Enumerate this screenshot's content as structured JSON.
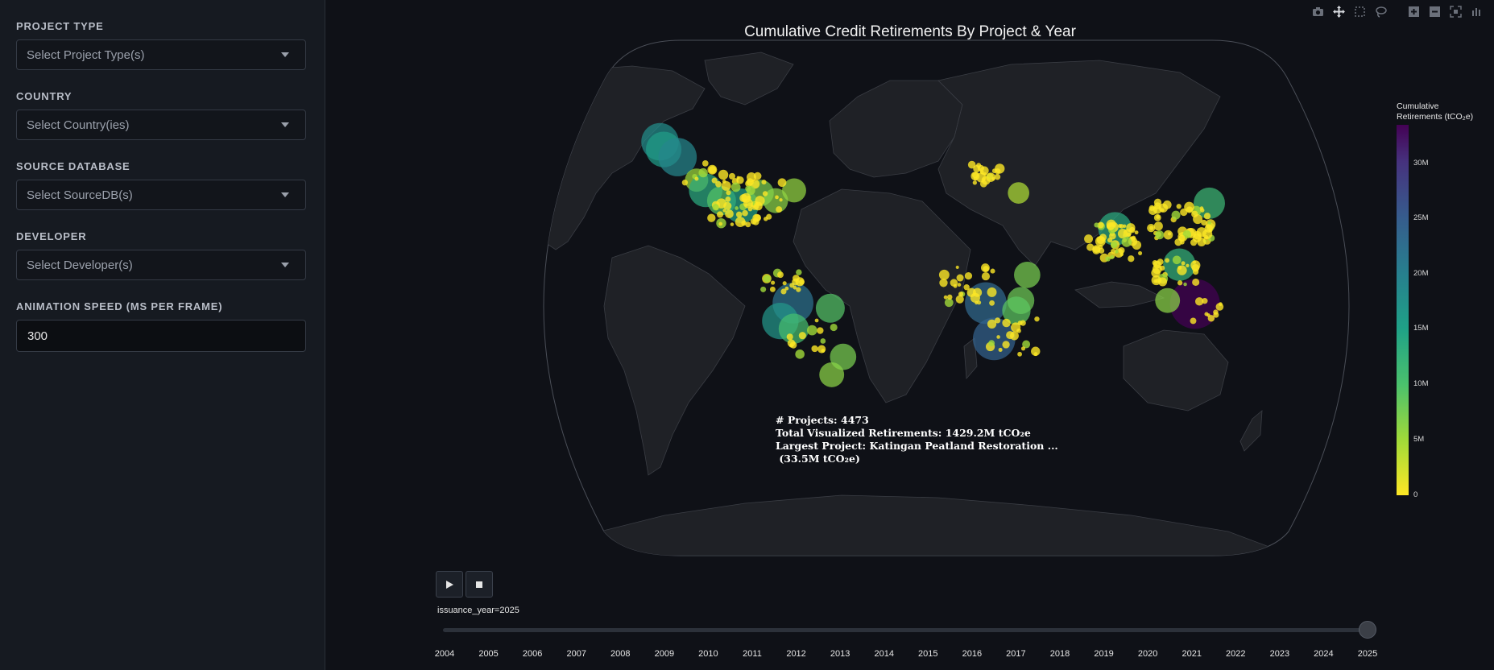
{
  "sidebar": {
    "filters": [
      {
        "label": "PROJECT TYPE",
        "placeholder": "Select Project Type(s)"
      },
      {
        "label": "COUNTRY",
        "placeholder": "Select Country(ies)"
      },
      {
        "label": "SOURCE DATABASE",
        "placeholder": "Select SourceDB(s)"
      },
      {
        "label": "DEVELOPER",
        "placeholder": "Select Developer(s)"
      }
    ],
    "speed": {
      "label": "ANIMATION SPEED (MS PER FRAME)",
      "value": "300"
    }
  },
  "modebar": {
    "icons": [
      "camera-icon",
      "pan-icon",
      "box-select-icon",
      "lasso-icon",
      "zoom-in-icon",
      "zoom-out-icon",
      "reset-view-icon",
      "plotly-logo-icon"
    ]
  },
  "chart": {
    "title": "Cumulative Credit Retirements By Project & Year",
    "annotation": "# Projects: 4473\nTotal Visualized Retirements: 1429.2M tCO₂e\nLargest Project: Katingan Peatland Restoration ...\n (33.5M tCO₂e)",
    "colorbar": {
      "title": "Cumulative\nRetirements (tCO₂e)",
      "ticks": [
        "30M",
        "25M",
        "20M",
        "15M",
        "10M",
        "5M",
        "0"
      ],
      "colors": [
        "#440154",
        "#46327e",
        "#365c8d",
        "#277f8e",
        "#1fa187",
        "#4ac16d",
        "#a0da39",
        "#fde725"
      ]
    },
    "slider": {
      "label": "issuance_year=2025",
      "years": [
        "2004",
        "2005",
        "2006",
        "2007",
        "2008",
        "2009",
        "2010",
        "2011",
        "2012",
        "2013",
        "2014",
        "2015",
        "2016",
        "2017",
        "2018",
        "2019",
        "2020",
        "2021",
        "2022",
        "2023",
        "2024",
        "2025"
      ],
      "current": "2025"
    },
    "play_icon": "play-icon",
    "stop_icon": "stop-icon"
  },
  "chart_data": {
    "type": "scatter",
    "subtype": "scatter_geo",
    "title": "Cumulative Credit Retirements By Project & Year",
    "colorbar_title": "Cumulative Retirements (tCO₂e)",
    "color_range": [
      0,
      33500000
    ],
    "projection": "robinson",
    "frame": "2025",
    "points": [
      {
        "lon": -150,
        "lat": 61,
        "value": 17000000
      },
      {
        "lon": -146,
        "lat": 58,
        "value": 15000000
      },
      {
        "lon": -137,
        "lat": 55,
        "value": 18000000
      },
      {
        "lon": -123,
        "lat": 46,
        "value": 5000000
      },
      {
        "lon": -117,
        "lat": 42,
        "value": 13000000
      },
      {
        "lon": -108,
        "lat": 38,
        "value": 9000000
      },
      {
        "lon": -98,
        "lat": 36,
        "value": 14000000
      },
      {
        "lon": -90,
        "lat": 41,
        "value": 7000000
      },
      {
        "lon": -82,
        "lat": 38,
        "value": 6000000
      },
      {
        "lon": -74,
        "lat": 42,
        "value": 5500000
      },
      {
        "lon": -70,
        "lat": -2,
        "value": 21000000
      },
      {
        "lon": -76,
        "lat": -9,
        "value": 16000000
      },
      {
        "lon": -70,
        "lat": -12,
        "value": 10000000
      },
      {
        "lon": -53,
        "lat": -4,
        "value": 9000000
      },
      {
        "lon": -48,
        "lat": -23,
        "value": 7000000
      },
      {
        "lon": -54,
        "lat": -30,
        "value": 6000000
      },
      {
        "lon": 18,
        "lat": -2,
        "value": 22000000
      },
      {
        "lon": 22,
        "lat": -16,
        "value": 23000000
      },
      {
        "lon": 34,
        "lat": -1,
        "value": 7500000
      },
      {
        "lon": 32,
        "lat": -5,
        "value": 8500000
      },
      {
        "lon": 37,
        "lat": 9,
        "value": 7000000
      },
      {
        "lon": 35,
        "lat": 41,
        "value": 4000000
      },
      {
        "lon": 79,
        "lat": 27,
        "value": 13000000
      },
      {
        "lon": 107,
        "lat": 13,
        "value": 12000000
      },
      {
        "lon": 126,
        "lat": 37,
        "value": 11000000
      },
      {
        "lon": 113.5,
        "lat": -2.3,
        "value": 33500000
      },
      {
        "lon": 101,
        "lat": -1,
        "value": 6000000
      }
    ],
    "annotation": {
      "projects": 4473,
      "total_retirements_mtco2e": 1429.2,
      "largest_project": "Katingan Peatland Restoration ...",
      "largest_project_mtco2e": 33.5
    },
    "slider_years": [
      2004,
      2005,
      2006,
      2007,
      2008,
      2009,
      2010,
      2011,
      2012,
      2013,
      2014,
      2015,
      2016,
      2017,
      2018,
      2019,
      2020,
      2021,
      2022,
      2023,
      2024,
      2025
    ]
  }
}
